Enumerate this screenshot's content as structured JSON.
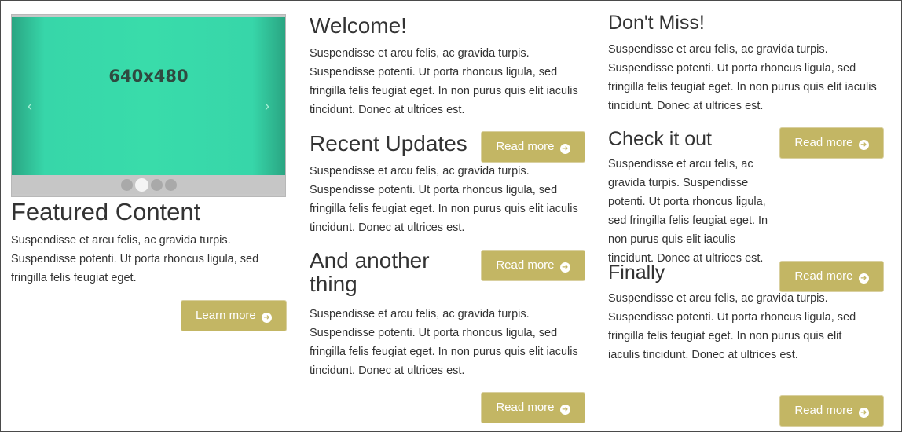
{
  "featured": {
    "slider": {
      "label": "640x480",
      "prev_icon": "chevron-left-icon",
      "next_icon": "chevron-right-icon",
      "dots_count": 4,
      "active_dot": 2
    },
    "title": "Featured Content",
    "text": "Suspendisse et arcu felis, ac gravida turpis. Suspendisse potenti. Ut porta rhoncus ligula, sed fringilla felis feugiat eget.",
    "button": "Learn more"
  },
  "middle": {
    "welcome": {
      "title": "Welcome!",
      "text": "Suspendisse et arcu felis, ac gravida turpis. Suspendisse potenti. Ut porta rhoncus ligula, sed fringilla felis feugiat eget. In non purus quis elit iaculis tincidunt. Donec at ultrices est."
    },
    "recent": {
      "title": "Recent Updates",
      "button": "Read more",
      "text": "Suspendisse et arcu felis, ac gravida turpis. Suspendisse potenti. Ut porta rhoncus ligula, sed fringilla felis feugiat eget. In non purus quis elit iaculis tincidunt. Donec at ultrices est."
    },
    "another": {
      "title_line1": "And another",
      "title_line2": "thing",
      "button": "Read more",
      "text": "Suspendisse et arcu felis, ac gravida turpis. Suspendisse potenti. Ut porta rhoncus ligula, sed fringilla felis feugiat eget. In non purus quis elit iaculis tincidunt. Donec at ultrices est."
    },
    "bottom_button": "Read more"
  },
  "right": {
    "dont_miss": {
      "title": "Don't Miss!",
      "text": "Suspendisse et arcu felis, ac gravida turpis. Suspendisse potenti. Ut porta rhoncus ligula, sed fringilla felis feugiat eget. In non purus quis elit iaculis tincidunt. Donec at ultrices est."
    },
    "check": {
      "title": "Check it out",
      "button": "Read more",
      "text": "Suspendisse et arcu felis, ac gravida turpis. Suspendisse potenti. Ut porta rhoncus ligula, sed fringilla felis feugiat eget. In non purus quis elit iaculis tincidunt. Donec at ultrices est."
    },
    "finally": {
      "title": "Finally",
      "button": "Read more",
      "text": "Suspendisse et arcu felis, ac gravida turpis. Suspendisse potenti. Ut porta rhoncus ligula, sed fringilla felis feugiat eget. In non purus quis elit iaculis tincidunt. Donec at ultrices est."
    },
    "bottom_button": "Read more"
  },
  "colors": {
    "button": "#c3b664",
    "slide": "#39dcaa"
  }
}
